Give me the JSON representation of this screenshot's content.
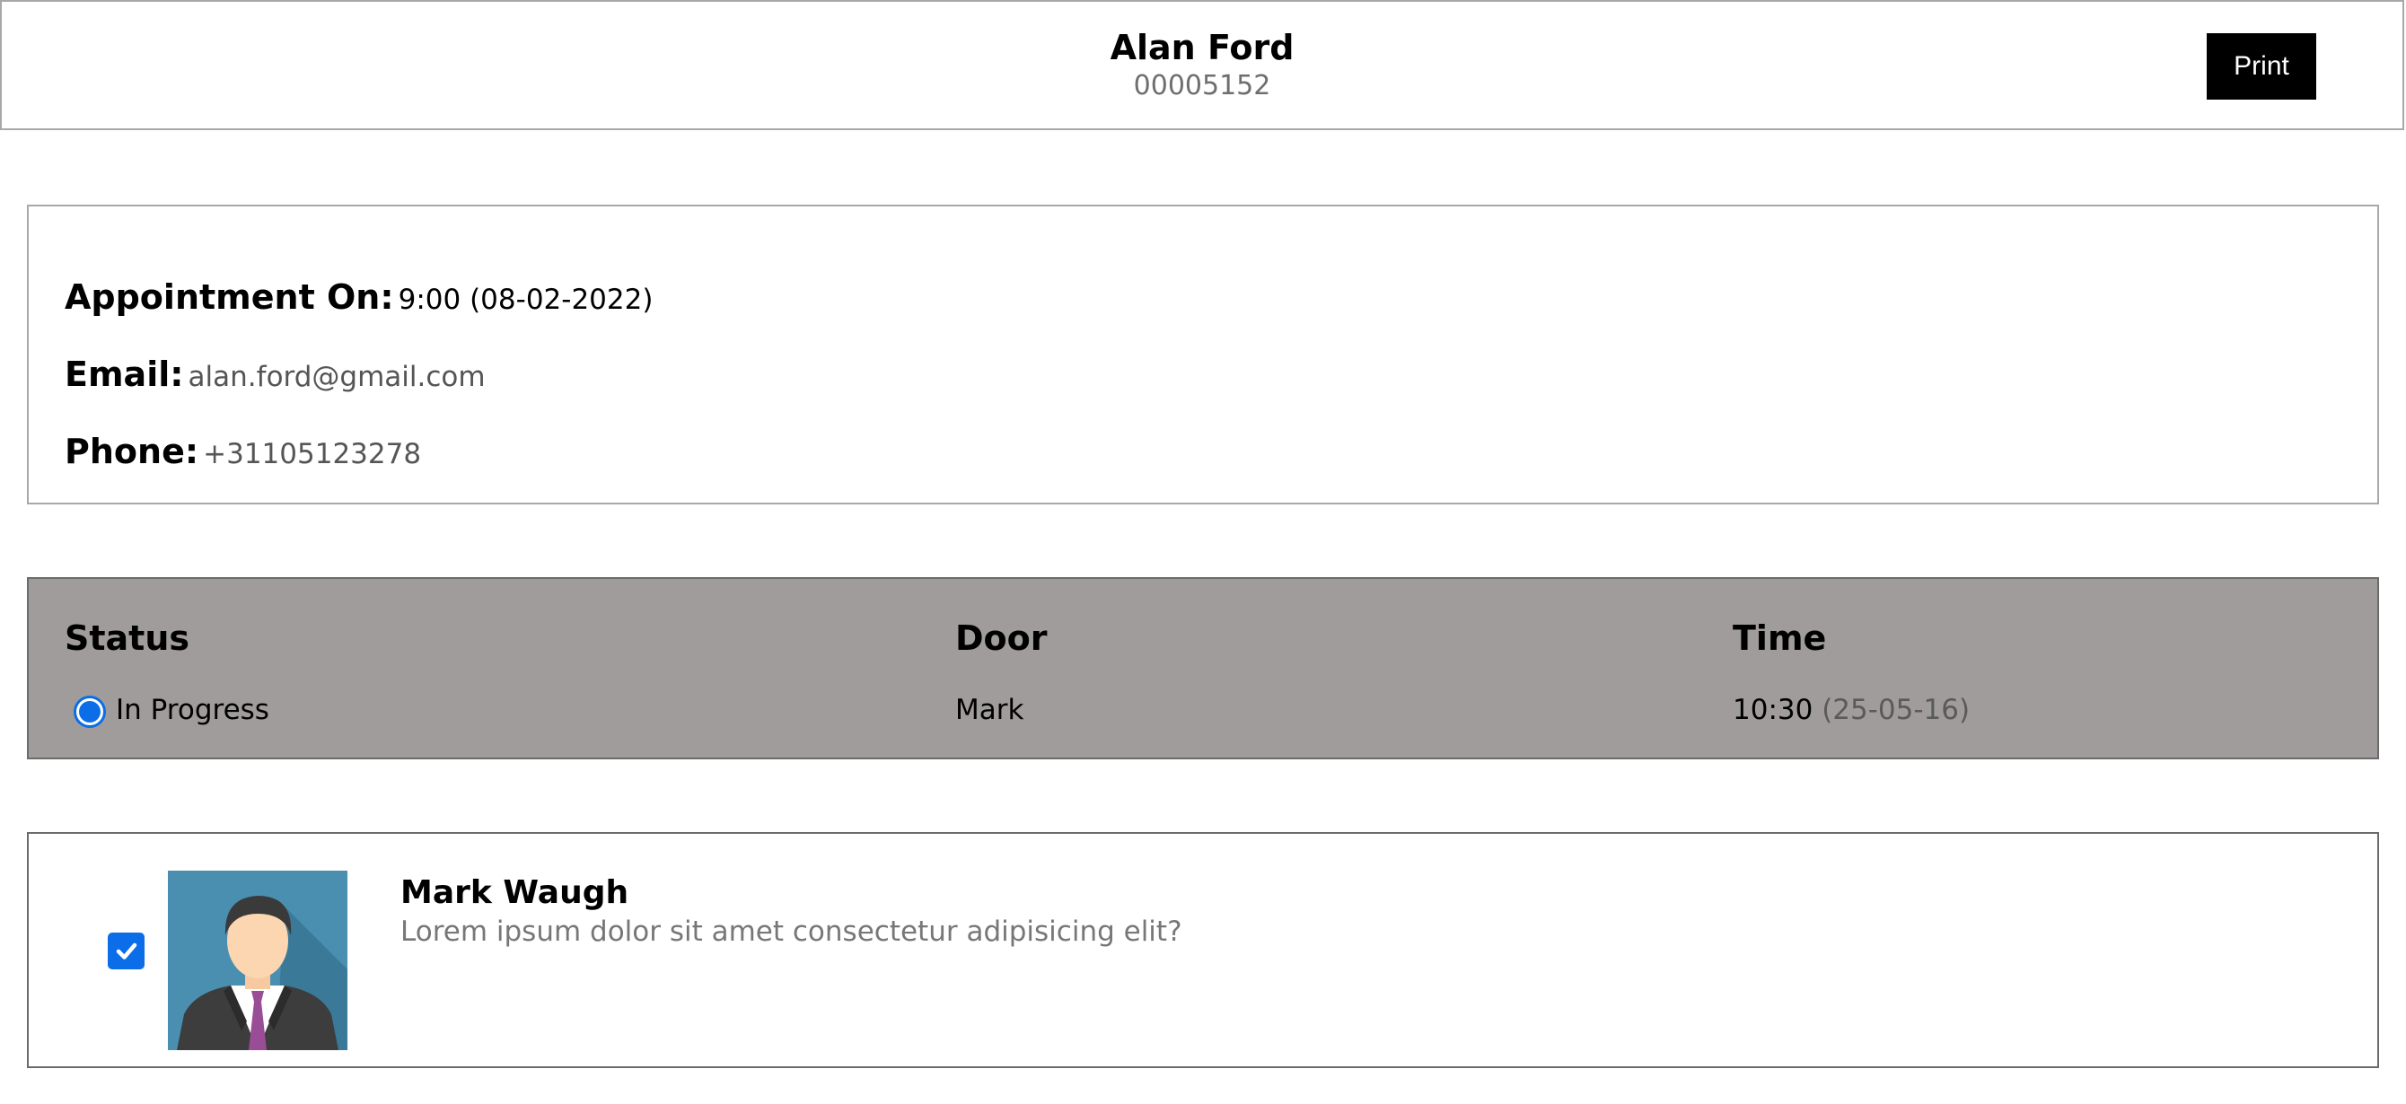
{
  "header": {
    "name": "Alan Ford",
    "id_number": "00005152",
    "print_label": "Print"
  },
  "info": {
    "appointment_label": "Appointment On:",
    "appointment_value": "9:00 (08-02-2022)",
    "email_label": "Email:",
    "email_value": "alan.ford@gmail.com",
    "phone_label": "Phone:",
    "phone_value": "+31105123278"
  },
  "status_panel": {
    "status_header": "Status",
    "door_header": "Door",
    "time_header": "Time",
    "status_value": "In Progress",
    "status_selected": true,
    "door_value": "Mark",
    "time_value": "10:30",
    "time_date": "(25-05-16)"
  },
  "person": {
    "name": "Mark Waugh",
    "description": "Lorem ipsum dolor sit amet consectetur adipisicing elit?",
    "checked": true,
    "avatar_icon": "businessman-avatar-icon"
  },
  "colors": {
    "accent": "#0b6ee8",
    "panel_bg": "#9f9c9b",
    "button_bg": "#000000",
    "avatar_bg": "#4b8fb0"
  }
}
